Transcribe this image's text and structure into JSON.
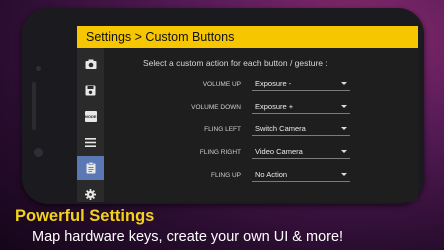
{
  "header": {
    "title": "Settings > Custom Buttons"
  },
  "instruction": "Select a custom action for each button / gesture :",
  "sidebar": {
    "items": [
      {
        "icon": "camera-icon"
      },
      {
        "icon": "save-icon"
      },
      {
        "icon": "mode-icon",
        "label": "MODE"
      },
      {
        "icon": "menu-icon"
      },
      {
        "icon": "clipboard-icon",
        "active": true
      },
      {
        "icon": "gear-icon"
      }
    ]
  },
  "rows": [
    {
      "label": "VOLUME UP",
      "value": "Exposure -"
    },
    {
      "label": "VOLUME DOWN",
      "value": "Exposure +"
    },
    {
      "label": "FLING LEFT",
      "value": "Switch Camera"
    },
    {
      "label": "FLING RIGHT",
      "value": "Video Camera"
    },
    {
      "label": "FLING UP",
      "value": "No Action"
    }
  ],
  "caption": {
    "heading": "Powerful Settings",
    "subtext": "Map hardware keys, create your own UI & more!"
  },
  "colors": {
    "accent": "#f6c600",
    "active_item": "#5a78b4",
    "heading": "#f2d21a"
  }
}
